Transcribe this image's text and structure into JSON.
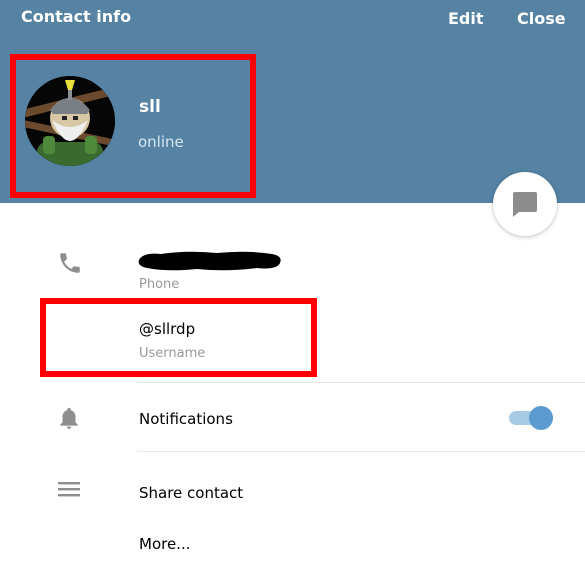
{
  "header": {
    "title": "Contact info",
    "edit_label": "Edit",
    "close_label": "Close"
  },
  "profile": {
    "name": "sll",
    "status": "online"
  },
  "info": {
    "phone_label": "Phone",
    "username_value": "@sllrdp",
    "username_label": "Username",
    "notifications_label": "Notifications",
    "notifications_enabled": true,
    "share_label": "Share contact",
    "more_label": "More..."
  },
  "colors": {
    "header_bg": "#5682a3",
    "accent": "#5b9bd1",
    "annotation_red": "#ff0000"
  },
  "icons": {
    "fab": "message-icon",
    "phone": "phone-icon",
    "notifications": "bell-icon",
    "share": "menu-icon"
  }
}
